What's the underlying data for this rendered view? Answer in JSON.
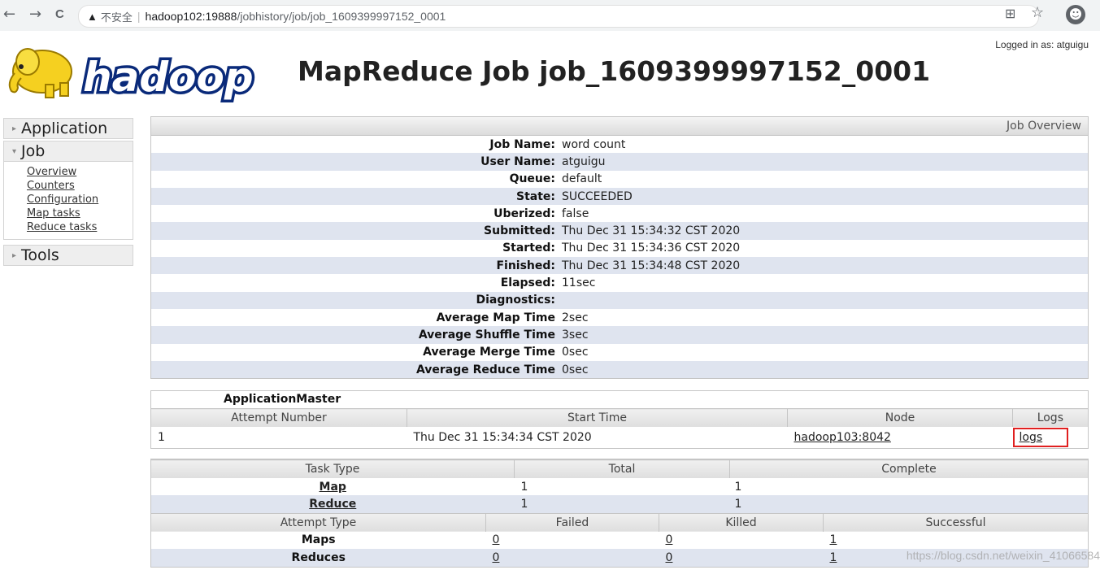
{
  "browser": {
    "back_icon": "←",
    "forward_icon": "→",
    "reload_icon": "C",
    "warning_icon": "▲",
    "insecure_label": "不安全",
    "separator": "|",
    "url_host": "hadoop102:19888",
    "url_path": "/jobhistory/job/job_1609399997152_0001",
    "translate_icon": "⊞",
    "star_icon": "☆",
    "profile_icon": "☻"
  },
  "header": {
    "logged_in": "Logged in as: atguigu",
    "logo_text": "hadoop",
    "title": "MapReduce Job job_1609399997152_0001"
  },
  "nav": {
    "application": "Application",
    "job": "Job",
    "job_links": [
      "Overview",
      "Counters",
      "Configuration",
      "Map tasks",
      "Reduce tasks"
    ],
    "tools": "Tools",
    "collapsed_icon": "▸",
    "expanded_icon": "▾"
  },
  "overview": {
    "header": "Job Overview",
    "rows": [
      {
        "k": "Job Name:",
        "v": "word count"
      },
      {
        "k": "User Name:",
        "v": "atguigu"
      },
      {
        "k": "Queue:",
        "v": "default"
      },
      {
        "k": "State:",
        "v": "SUCCEEDED"
      },
      {
        "k": "Uberized:",
        "v": "false"
      },
      {
        "k": "Submitted:",
        "v": "Thu Dec 31 15:34:32 CST 2020"
      },
      {
        "k": "Started:",
        "v": "Thu Dec 31 15:34:36 CST 2020"
      },
      {
        "k": "Finished:",
        "v": "Thu Dec 31 15:34:48 CST 2020"
      },
      {
        "k": "Elapsed:",
        "v": "11sec"
      },
      {
        "k": "Diagnostics:",
        "v": ""
      },
      {
        "k": "Average Map Time",
        "v": "2sec"
      },
      {
        "k": "Average Shuffle Time",
        "v": "3sec"
      },
      {
        "k": "Average Merge Time",
        "v": "0sec"
      },
      {
        "k": "Average Reduce Time",
        "v": "0sec"
      }
    ]
  },
  "app_master": {
    "title": "ApplicationMaster",
    "headers": [
      "Attempt Number",
      "Start Time",
      "Node",
      "Logs"
    ],
    "attempt": "1",
    "start_time": "Thu Dec 31 15:34:34 CST 2020",
    "node": "hadoop103:8042",
    "logs": "logs"
  },
  "tasks": {
    "headers": [
      "Task Type",
      "Total",
      "Complete"
    ],
    "rows": [
      {
        "type": "Map",
        "total": "1",
        "complete": "1"
      },
      {
        "type": "Reduce",
        "total": "1",
        "complete": "1"
      }
    ],
    "attempt_headers": [
      "Attempt Type",
      "Failed",
      "Killed",
      "Successful"
    ],
    "attempt_rows": [
      {
        "type": "Maps",
        "failed": "0",
        "killed": "0",
        "successful": "1"
      },
      {
        "type": "Reduces",
        "failed": "0",
        "killed": "0",
        "successful": "1"
      }
    ]
  },
  "watermark": "https://blog.csdn.net/weixin_41066584"
}
